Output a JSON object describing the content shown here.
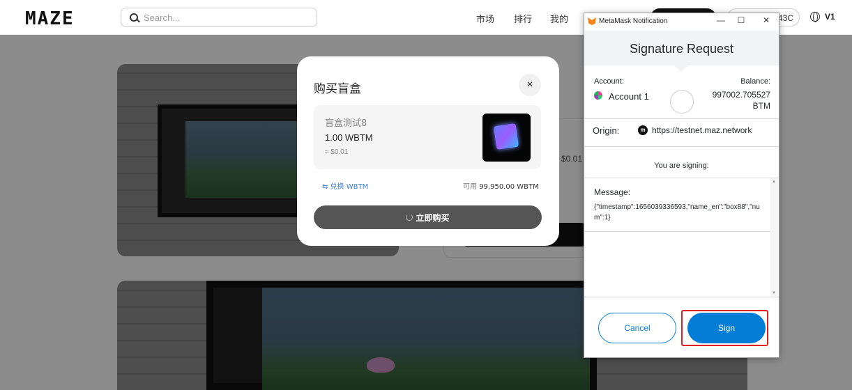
{
  "header": {
    "logo": "MAZE",
    "search_placeholder": "Search...",
    "nav": [
      "市场",
      "排行",
      "我的"
    ],
    "address_suffix": "43C",
    "version": "V1"
  },
  "background": {
    "price": "$0.01"
  },
  "purchase_modal": {
    "title": "购买盲盒",
    "close": "×",
    "item_name": "盲盒测试8",
    "item_price": "1.00 WBTM",
    "item_usd": "≈ $0.01",
    "swap_link": "⇆ 兑换 WBTM",
    "available_label": "可用",
    "available_value": "99,950.00 WBTM",
    "buy_button": "立即购买"
  },
  "metamask": {
    "window_title": "MetaMask Notification",
    "window_controls": [
      "—",
      "☐",
      "✕"
    ],
    "heading": "Signature Request",
    "account_label": "Account:",
    "account_name": "Account 1",
    "balance_label": "Balance:",
    "balance_value": "997002.705527 BTM",
    "origin_label": "Origin:",
    "origin_icon": "m",
    "origin_url": "https://testnet.maz.network",
    "signing_text": "You are signing:",
    "message_label": "Message:",
    "message_text": "{\"timestamp\":1656039336593,\"name_en\":\"box88\",\"num\":1}",
    "cancel_button": "Cancel",
    "sign_button": "Sign"
  }
}
